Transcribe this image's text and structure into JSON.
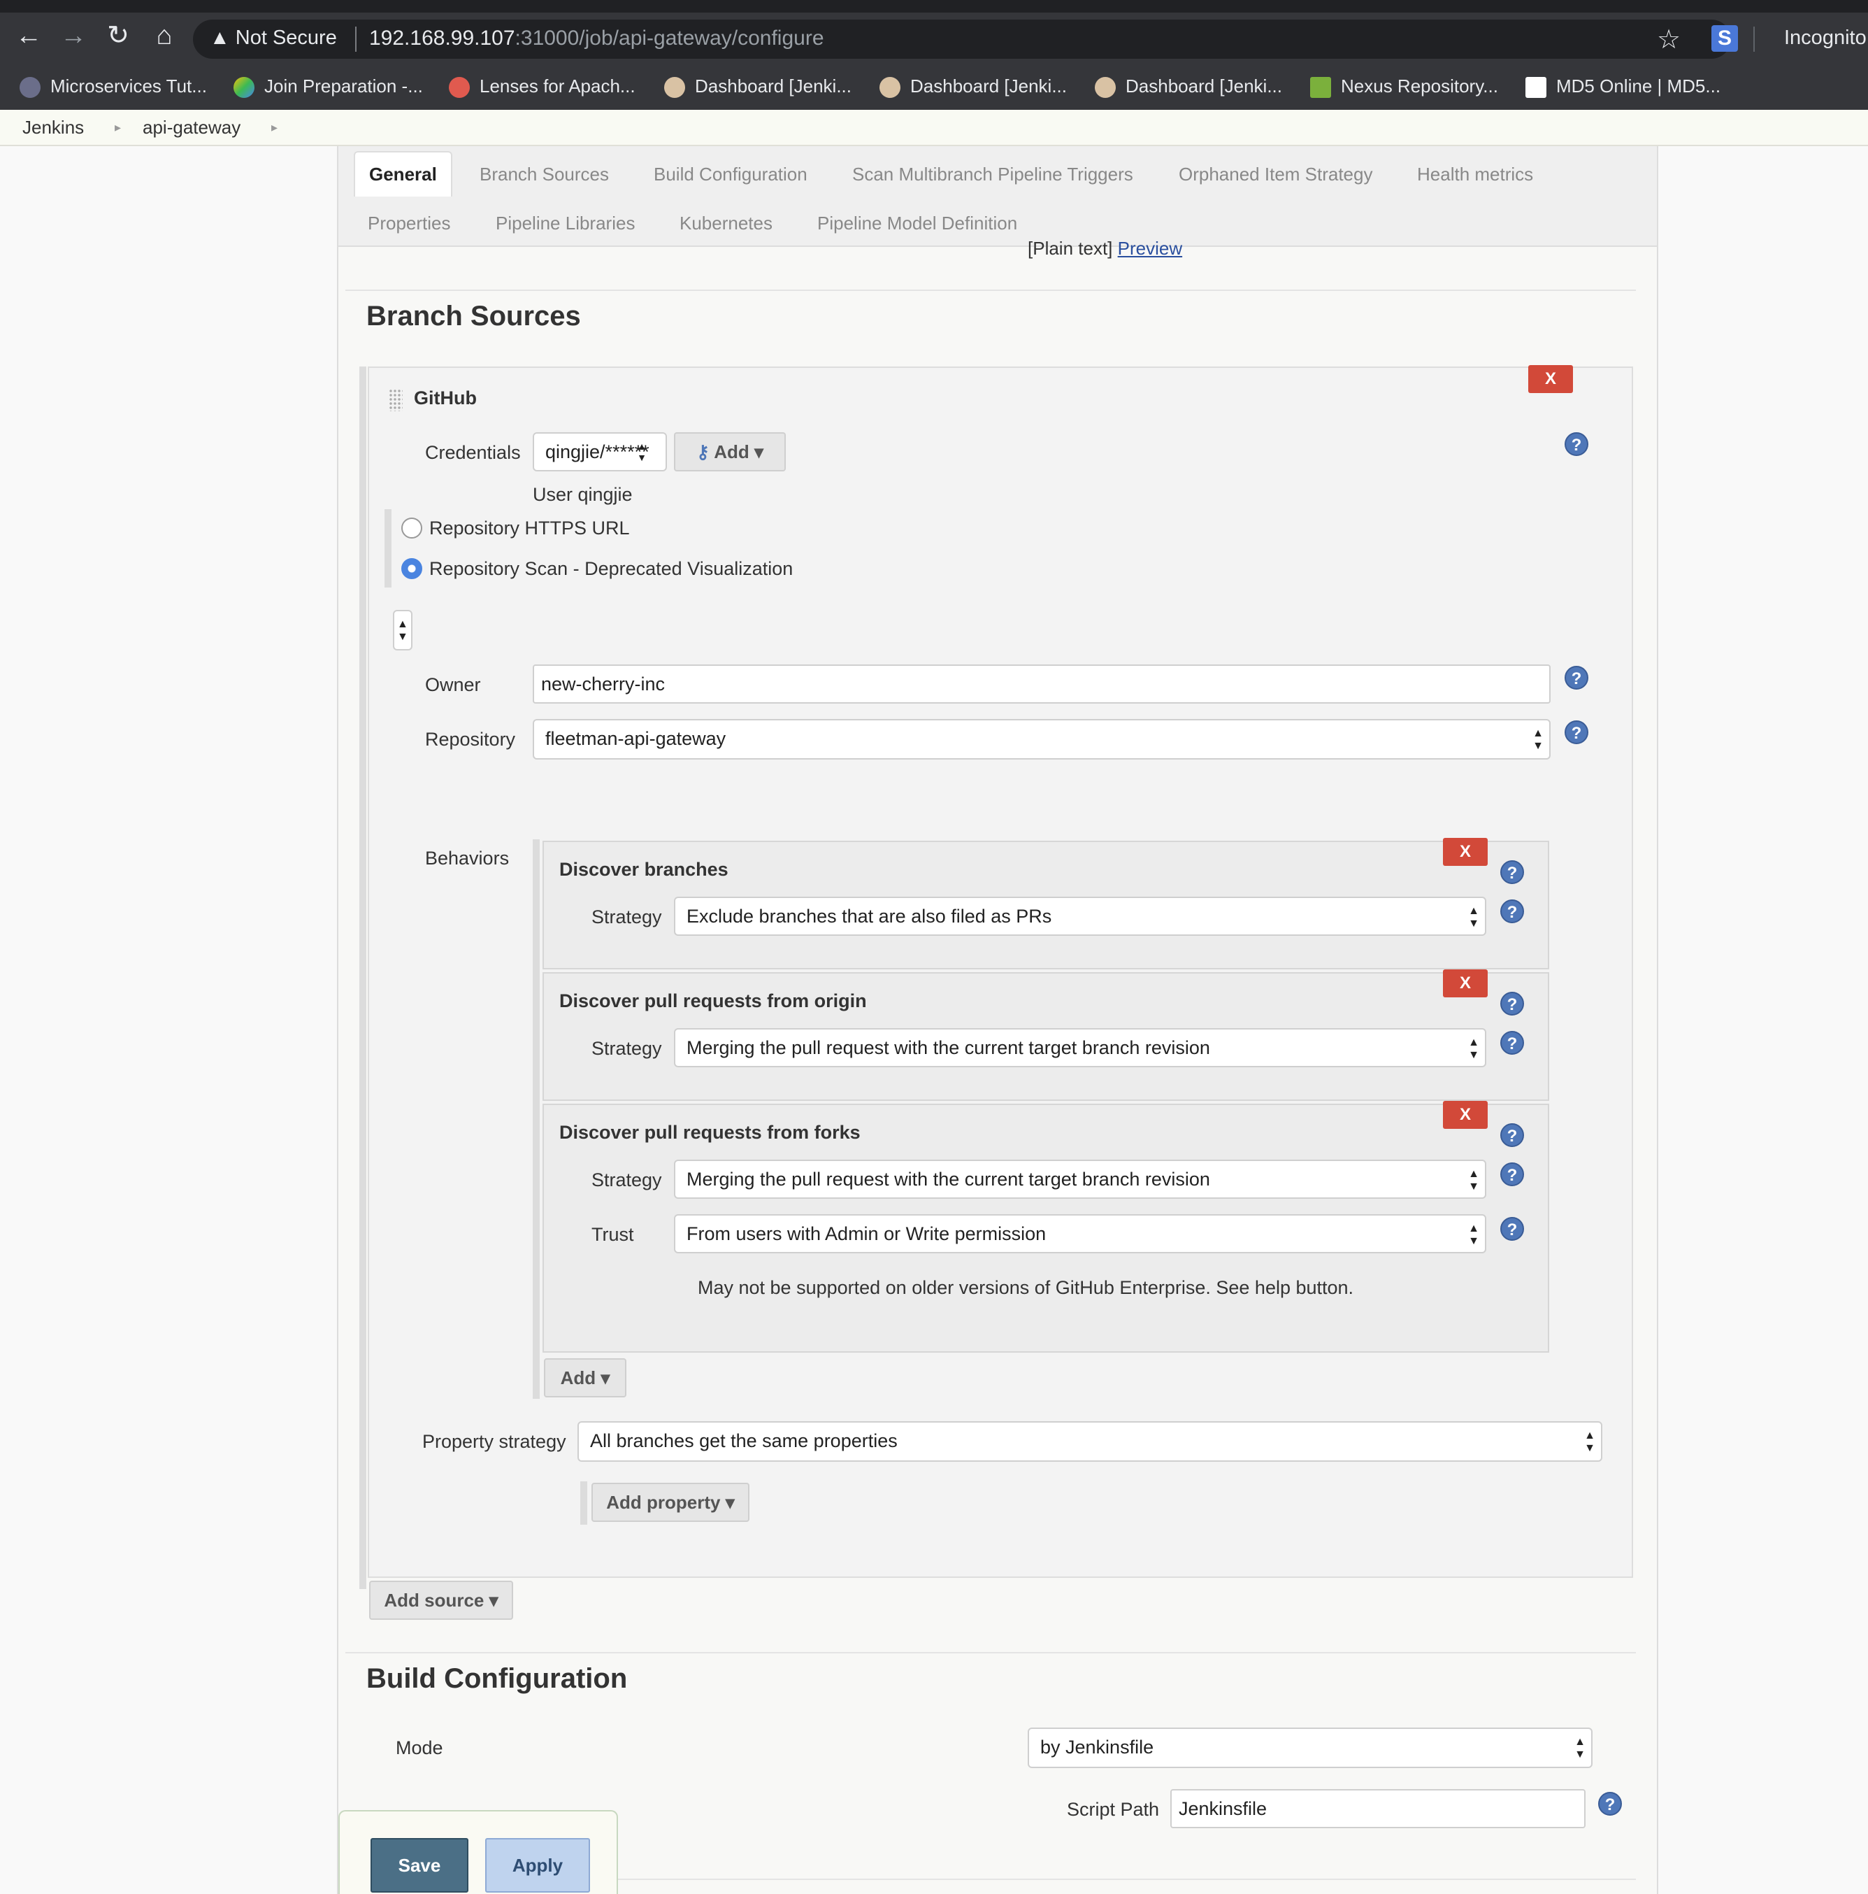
{
  "browser": {
    "not_secure": "Not Secure",
    "url_host": "192.168.99.107",
    "url_rest": ":31000/job/api-gateway/configure",
    "incognito": "Incognito",
    "bookmarks": [
      "Microservices Tut...",
      "Join Preparation -...",
      "Lenses for Apach...",
      "Dashboard [Jenki...",
      "Dashboard [Jenki...",
      "Dashboard [Jenki...",
      "Nexus Repository...",
      "MD5 Online | MD5..."
    ]
  },
  "breadcrumb": [
    "Jenkins",
    "api-gateway"
  ],
  "tabs": {
    "general": "General",
    "branch_sources": "Branch Sources",
    "build_configuration": "Build Configuration",
    "scan_triggers": "Scan Multibranch Pipeline Triggers",
    "orphaned": "Orphaned Item Strategy",
    "health": "Health metrics",
    "properties": "Properties",
    "pipeline_libraries": "Pipeline Libraries",
    "kubernetes": "Kubernetes",
    "pipeline_model": "Pipeline Model Definition"
  },
  "description": {
    "plain_text": "[Plain text]",
    "preview": "Preview"
  },
  "branch_sources": {
    "title": "Branch Sources",
    "source_name": "GitHub",
    "delete_label": "X",
    "credentials_label": "Credentials",
    "credentials_value": "qingjie/******",
    "add_label": "Add",
    "credentials_user": "User qingjie",
    "radio_https": "Repository HTTPS URL",
    "radio_scan": "Repository Scan - Deprecated Visualization",
    "owner_label": "Owner",
    "owner_value": "new-cherry-inc",
    "repository_label": "Repository",
    "repository_value": "fleetman-api-gateway",
    "behaviors_label": "Behaviors",
    "behaviors": [
      {
        "title": "Discover branches",
        "strategy_label": "Strategy",
        "strategy": "Exclude branches that are also filed as PRs"
      },
      {
        "title": "Discover pull requests from origin",
        "strategy_label": "Strategy",
        "strategy": "Merging the pull request with the current target branch revision"
      },
      {
        "title": "Discover pull requests from forks",
        "strategy_label": "Strategy",
        "strategy": "Merging the pull request with the current target branch revision",
        "trust_label": "Trust",
        "trust": "From users with Admin or Write permission",
        "note": "May not be supported on older versions of GitHub Enterprise. See help button."
      }
    ],
    "behaviors_add": "Add",
    "property_strategy_label": "Property strategy",
    "property_strategy_value": "All branches get the same properties",
    "add_property": "Add property",
    "add_source": "Add source"
  },
  "build_configuration": {
    "title": "Build Configuration",
    "mode_label": "Mode",
    "mode_value": "by Jenkinsfile",
    "script_path_label": "Script Path",
    "script_path_value": "Jenkinsfile"
  },
  "actions": {
    "save": "Save",
    "apply": "Apply"
  },
  "help_glyph": "?",
  "select_arrows": "▲▼",
  "colors": {
    "accent": "#4b6f86",
    "danger": "#d24939",
    "help": "#4f77b8"
  }
}
